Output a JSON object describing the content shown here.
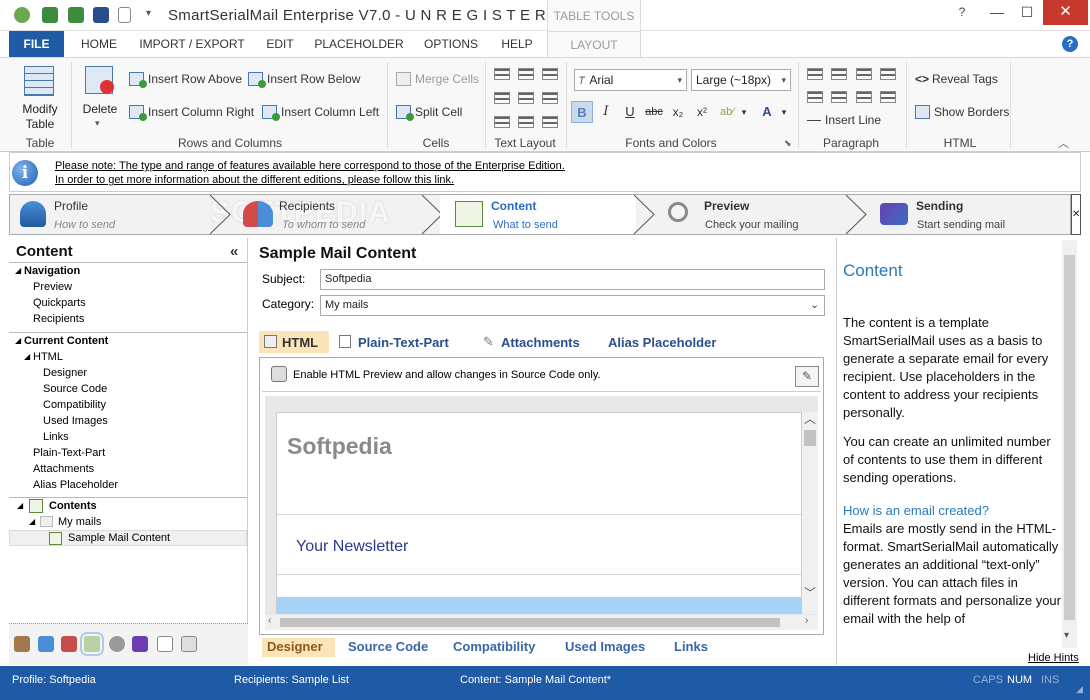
{
  "window": {
    "title": "SmartSerialMail Enterprise V7.0 - U N R E G I S T E R E ...",
    "context_tab": "TABLE TOOLS"
  },
  "tabs": {
    "file": "FILE",
    "home": "HOME",
    "import_export": "IMPORT / EXPORT",
    "edit": "EDIT",
    "placeholder": "PLACEHOLDER",
    "options": "OPTIONS",
    "help": "HELP",
    "layout": "LAYOUT"
  },
  "ribbon": {
    "modify_table_1": "Modify",
    "modify_table_2": "Table",
    "delete": "Delete",
    "insert_row_above": "Insert Row Above",
    "insert_row_below": "Insert Row Below",
    "insert_col_right": "Insert Column Right",
    "insert_col_left": "Insert Column Left",
    "merge_cells": "Merge Cells",
    "split_cell": "Split Cell",
    "font_name": "Arial",
    "font_size": "Large (~18px)",
    "insert_line": "Insert Line",
    "reveal_tags": "Reveal Tags",
    "show_borders": "Show Borders",
    "groups": {
      "table": "Table",
      "rows_cols": "Rows and Columns",
      "cells": "Cells",
      "text_layout": "Text Layout",
      "fonts_colors": "Fonts and Colors",
      "paragraph": "Paragraph",
      "html": "HTML"
    }
  },
  "info": {
    "line1": "Please note: The type and range of features available here correspond to those of the Enterprise Edition.",
    "line2": "In order to get more information about the different editions, please follow this link."
  },
  "steps": [
    {
      "title": "Profile",
      "subtitle": "How to send"
    },
    {
      "title": "Recipients",
      "subtitle": "To whom to send"
    },
    {
      "title": "Content",
      "subtitle": "What to send"
    },
    {
      "title": "Preview",
      "subtitle": "Check your mailing"
    },
    {
      "title": "Sending",
      "subtitle": "Start sending mail"
    }
  ],
  "watermark": "SOFTPEDIA",
  "left": {
    "header": "Content",
    "collapse": "«",
    "navigation": "Navigation",
    "nav_items": [
      "Preview",
      "Quickparts",
      "Recipients"
    ],
    "current_content": "Current Content",
    "html": "HTML",
    "html_items": [
      "Designer",
      "Source Code",
      "Compatibility",
      "Used Images",
      "Links"
    ],
    "plain_text": "Plain-Text-Part",
    "attachments": "Attachments",
    "alias": "Alias Placeholder",
    "contents": "Contents",
    "my_mails": "My mails",
    "sample_mail": "Sample Mail Content"
  },
  "center": {
    "title": "Sample Mail Content",
    "subject_label": "Subject:",
    "subject_value": "Softpedia",
    "category_label": "Category:",
    "category_value": "My mails",
    "tabs": [
      "HTML",
      "Plain-Text-Part",
      "Attachments",
      "Alias Placeholder"
    ],
    "preview_note": "Enable HTML Preview and allow changes in Source Code only.",
    "doc_heading": "Softpedia",
    "doc_newsletter": "Your Newsletter",
    "bottom_tabs": [
      "Designer",
      "Source Code",
      "Compatibility",
      "Used Images",
      "Links"
    ]
  },
  "help": {
    "title": "Content",
    "p1": "The content is a template SmartSerialMail uses as a basis to generate a separate email for every recipient. Use placeholders in the content to address your recipients personally.",
    "p2": "You can create an unlimited number of contents to use them in different sending operations.",
    "q": "How is an email created?",
    "p3": "Emails are mostly send in the HTML-format. SmartSerialMail automatically generates an additional “text-only” version. You can attach files in different formats and personalize your email with the help of",
    "hide": "Hide Hints"
  },
  "status": {
    "profile": "Profile: Softpedia",
    "recipients": "Recipients: Sample List",
    "content": "Content: Sample Mail Content*",
    "caps": "CAPS",
    "num": "NUM",
    "ins": "INS"
  },
  "colors": {
    "accent": "#1e5aa5",
    "link": "#2a4f8c",
    "selected_tab_bg": "#fbe4b8"
  }
}
